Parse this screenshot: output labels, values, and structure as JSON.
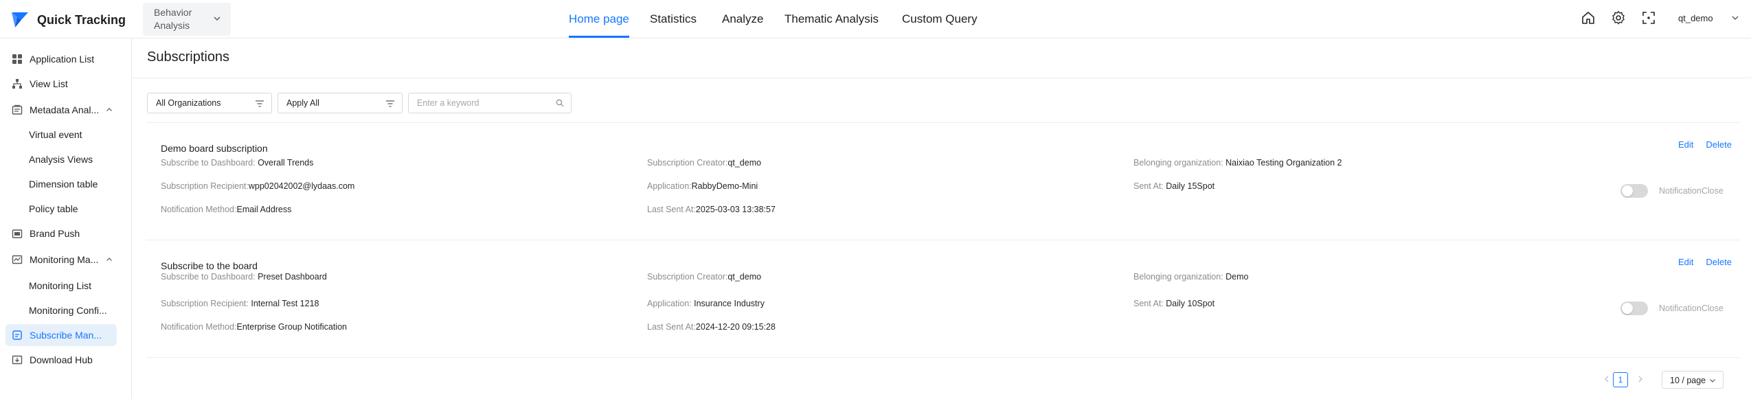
{
  "app": {
    "name": "Quick Tracking",
    "scope_select": "Behavior Analysis",
    "user": "qt_demo",
    "brand_color": "#1677ff"
  },
  "nav": {
    "items": [
      "Home page",
      "Statistics",
      "Analyze",
      "Thematic Analysis",
      "Custom Query"
    ],
    "active": "Home page"
  },
  "header_icons": [
    "home-icon",
    "settings-gear-icon",
    "fullscreen-icon"
  ],
  "sidebar": {
    "items": [
      {
        "label": "Application List",
        "icon": "grid-apps-icon"
      },
      {
        "label": "View List",
        "icon": "tree-structure-icon"
      },
      {
        "label": "Metadata Anal...",
        "icon": "metadata-icon",
        "expanded": true
      },
      {
        "label": "Virtual event"
      },
      {
        "label": "Analysis Views"
      },
      {
        "label": "Dimension table"
      },
      {
        "label": "Policy table"
      },
      {
        "label": "Brand Push",
        "icon": "push-icon"
      },
      {
        "label": "Monitoring Ma...",
        "icon": "monitor-icon",
        "expanded": true
      },
      {
        "label": "Monitoring List"
      },
      {
        "label": "Monitoring Confi..."
      },
      {
        "label": "Subscribe Man...",
        "icon": "subscribe-icon",
        "active": true
      },
      {
        "label": "Download Hub",
        "icon": "download-icon"
      }
    ]
  },
  "page": {
    "title": "Subscriptions"
  },
  "filters": {
    "organization": "All Organizations",
    "application": "Apply All",
    "search_placeholder": "Enter a keyword"
  },
  "labels": {
    "dashboard": "Subscribe to Dashboard:",
    "creator": "Subscription Creator:",
    "organization": "Belonging organization:",
    "recipient": "Subscription Recipient:",
    "application": "Application:",
    "sent_at": "Sent At:",
    "method": "Notification Method:",
    "last_sent": "Last Sent At:",
    "edit": "Edit",
    "delete": "Delete",
    "notification_close": "NotificationClose"
  },
  "subscriptions": [
    {
      "title": "Demo board subscription",
      "dashboard": "Overall Trends",
      "creator": "qt_demo",
      "organization": "Naixiao Testing Organization 2",
      "recipient": "wpp02042002@lydaas.com",
      "application": "RabbyDemo-Mini",
      "sent_at": "Daily 15Spot",
      "method": "Email Address",
      "last_sent": "2025-03-03 13:38:57",
      "enabled": false
    },
    {
      "title": "Subscribe to the board",
      "dashboard": "Preset Dashboard",
      "creator": "qt_demo",
      "organization": "Demo",
      "recipient": "Internal Test 1218",
      "application": "Insurance Industry",
      "sent_at": "Daily 10Spot",
      "method": "Enterprise Group Notification",
      "last_sent": "2024-12-20 09:15:28",
      "enabled": false
    }
  ],
  "pagination": {
    "current_page": "1",
    "page_size": "10 / page"
  }
}
